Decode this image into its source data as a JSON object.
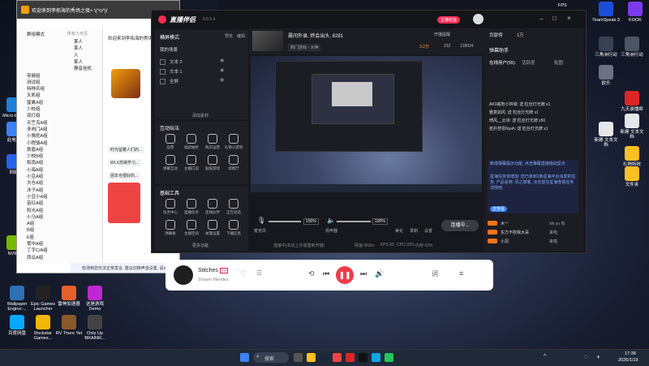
{
  "desktop": {
    "icons_left": [
      {
        "label": "Micro Edge",
        "color": "#1e7fd8"
      },
      {
        "label": "此电脑",
        "color": "#3b82f6"
      },
      {
        "label": "网络",
        "color": "#2563eb"
      },
      {
        "label": "NVIDI",
        "color": "#76b900"
      },
      {
        "label": "Wallpaper Engine:...",
        "color": "#2f6fb3"
      },
      {
        "label": "Epic Games Launcher",
        "color": "#222222"
      },
      {
        "label": "雷神加速器",
        "color": "#e4602a"
      },
      {
        "label": "这是游戏 Demo",
        "color": "#c026d3"
      },
      {
        "label": "百度网盘",
        "color": "#06a7ff"
      },
      {
        "label": "Rockstar Games...",
        "color": "#f2b705"
      },
      {
        "label": "RV There Yet",
        "color": "#8b5a2b"
      },
      {
        "label": "Only Up BRAINR...",
        "color": "#444444"
      }
    ],
    "icons_right": [
      {
        "label": "KOOK",
        "color": "#7c3aed"
      },
      {
        "label": "TeamSpeak 3",
        "color": "#1d4ed8"
      },
      {
        "label": "三角洲行动",
        "color": "#374151"
      },
      {
        "label": "三角洲行动",
        "color": "#4b5563"
      },
      {
        "label": "欧乐",
        "color": "#6b7280"
      },
      {
        "label": "新建 文本文档",
        "color": "#e5e7eb"
      },
      {
        "label": "九天录播姬",
        "color": "#dc2626"
      },
      {
        "label": "新建 文本文档",
        "color": "#e5e7eb"
      },
      {
        "label": "文件夹",
        "color": "#fbbf24"
      },
      {
        "label": "礼物特效",
        "color": "#fbbf24"
      }
    ]
  },
  "chat_window": {
    "title": "欢迎来到李拓海的秀场之夜+ \\(^o^)/",
    "left_header": "群组模式",
    "left_header2": "所有人可见",
    "members": [
      "某人",
      "某人",
      "人",
      "某人",
      "静音挂机",
      "穿越组",
      "测试组",
      "特种兵组",
      "天凯组",
      "猛禽A组",
      "少校组",
      "双打组",
      "天竺鸟A组",
      "多肉门A组",
      "小骆驼A组",
      "小程骆A组",
      "铁盾A组",
      "少校B组",
      "和雨A组",
      "小海A组",
      "小豆A组",
      "大仓A组",
      "沐子A组",
      "小豆小A组",
      "苗红A组",
      "阳光A组",
      "小马A组",
      "A组",
      "B组",
      "E座",
      "鹭中A组",
      "丁字C/A组",
      "西瓜A组"
    ],
    "notice": "欢迎来到李拓海的秀场",
    "messages": [
      "时光留着人们的...",
      "WLX苏婧学习...",
      "团本也很好的..."
    ],
    "bottom_status": "检测到您无法正常发言, 建议切换声音设置, 请点击"
  },
  "live_app": {
    "logo": "直播伴侣",
    "version": "6.5.5.4",
    "user_badge": "主播权益",
    "stream_title": "晨间外录, 终会出头, 8281",
    "tags": [
      "热门游戏 - 大神",
      "开播提醒",
      "美颜特效"
    ],
    "stats": {
      "viewers": "232",
      "likes": "218024",
      "rank": "3.2万"
    },
    "scene_mode": "横屏模式",
    "scene_tabs": [
      "预览",
      "编辑"
    ],
    "scene_panel_title": "我的场景",
    "scene_items": [
      "文本 2",
      "文本 1",
      "全屏"
    ],
    "add_material": "添加素材",
    "interact_title": "互动玩法",
    "interact_tools": [
      "投票",
      "福袋抽奖",
      "购买运营",
      "礼物小游戏",
      "弹幕互动",
      "主播口袋",
      "贴纸游戏",
      "演唱厅"
    ],
    "base_title": "基础工具",
    "base_tools": [
      "任务中心",
      "直播任务",
      "连线伙伴",
      "正在说话",
      "弹幕板",
      "主播空间",
      "关键设置",
      "下播信息"
    ],
    "more_tools": "更多功能",
    "mic_label": "麦克风",
    "mic_value": "100%",
    "speaker_label": "扬声器",
    "speaker_value": "100%",
    "bottom_icons": [
      "美化",
      "录制",
      "设置"
    ],
    "go_live_button": "连播中...",
    "status_line": "连接中(本进上手需重新开播)",
    "perf": {
      "net": "网速 0Kb/s",
      "fps": "FPS 60",
      "cpu": "CPU 32%",
      "mem": "内存 42%"
    },
    "right_title": "弹幕助手",
    "right_tabs": [
      "在线用户(55)",
      "活跃度",
      "贴图"
    ],
    "right_top": [
      "贡献榜",
      "1万"
    ],
    "right_messages": [
      "AK3威地小林城: 送 粒丝灯光牌 x1",
      "雅意如风: 送 粒丝灯光牌 x1",
      "琦风__云诗: 送 粒丝灯光牌 x50",
      "拓扑舒恩Nyah: 送 粒丝灯光牌 x1"
    ],
    "tip_blue": "新增弹幕提示功能, 点击弹幕直接拖动显示",
    "tip_blue2": "星海任务单增加: 您已收到1条星海平台派发的任务, 产品名称: 风之旅客, 点击前往星海查看任务详情吧.",
    "tip_link": "去查看",
    "right_users": [
      "木一",
      "东方不败我大哥",
      "小羽"
    ],
    "right_badges": [
      "shi yu 有",
      "来啦",
      "来啦"
    ]
  },
  "music_player": {
    "title": "Stitches",
    "artist": "Shawn Mendes",
    "badge": "VIP"
  },
  "clock": {
    "time": "17:38",
    "date": "2026/1/19"
  },
  "taskbar": {
    "search_placeholder": "搜索"
  },
  "tray_top": {
    "fps": "FPS",
    "temp": "40°C"
  }
}
